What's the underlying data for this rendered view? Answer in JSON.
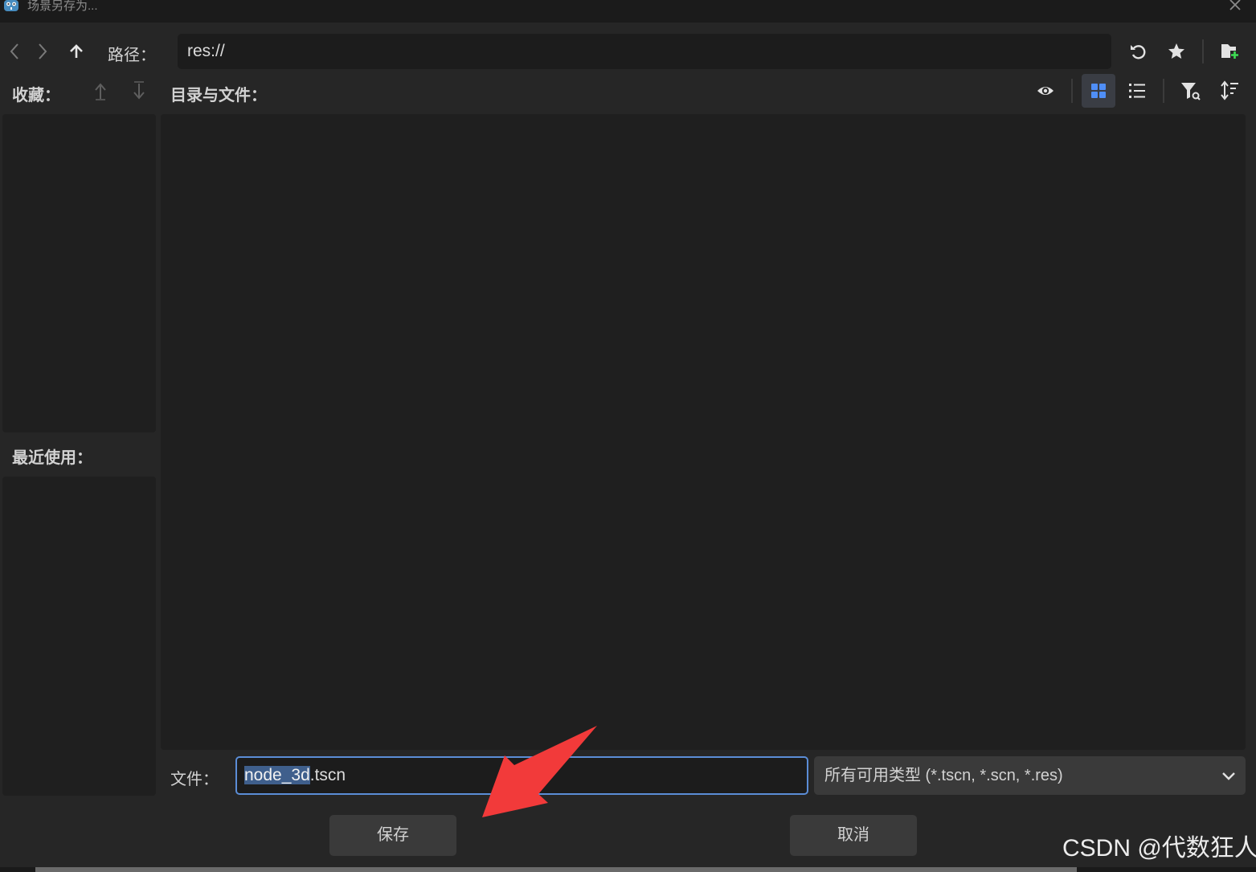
{
  "window": {
    "title": "场景另存为..."
  },
  "toolbar": {
    "path_label": "路径：",
    "path_value": "res://"
  },
  "favorites": {
    "label": "收藏："
  },
  "files": {
    "label": "目录与文件："
  },
  "recent": {
    "label": "最近使用："
  },
  "file_field": {
    "label": "文件：",
    "value_selected": "node_3d",
    "value_rest": ".tscn"
  },
  "filter": {
    "selected": "所有可用类型 (*.tscn, *.scn, *.res)"
  },
  "buttons": {
    "save": "保存",
    "cancel": "取消"
  },
  "watermark": "CSDN @代数狂人",
  "icons": {
    "back": "chevron-left-icon",
    "forward": "chevron-right-icon",
    "up": "arrow-up-icon",
    "refresh": "refresh-icon",
    "favorite": "star-icon",
    "new_folder": "new-folder-icon",
    "move_up": "move-up-icon",
    "move_down": "move-down-icon",
    "hidden_files": "eye-icon",
    "grid_view": "grid-icon",
    "list_view": "list-icon",
    "filter": "filter-icon",
    "sort": "sort-icon",
    "dropdown": "chevron-down-icon"
  },
  "colors": {
    "accent": "#5b8dd6",
    "grid_icon": "#4f8ef7",
    "new_folder_plus": "#3ddc53",
    "arrow": "#f23a3a"
  }
}
